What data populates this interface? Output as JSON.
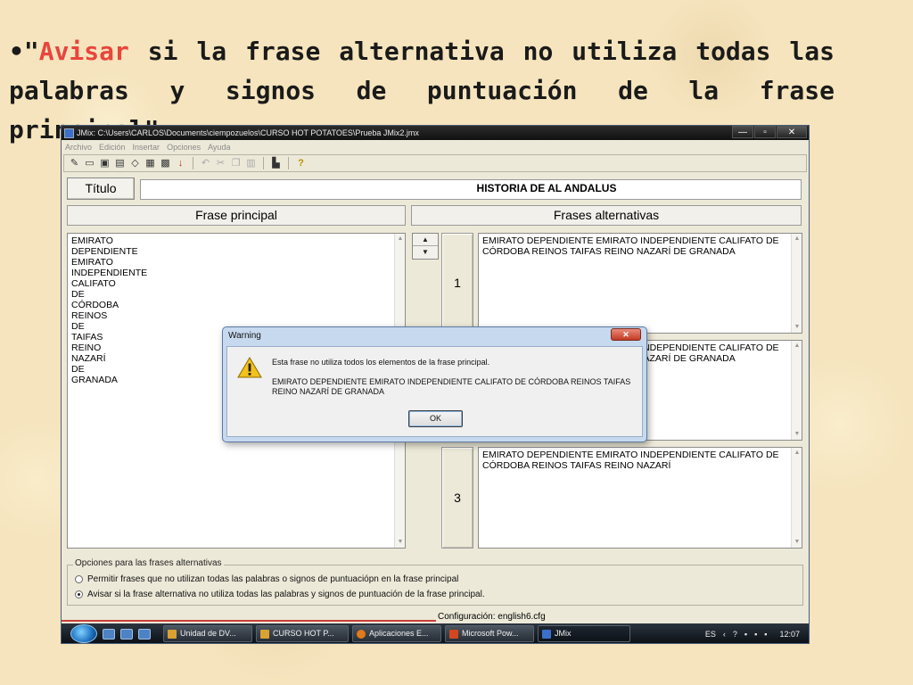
{
  "slide": {
    "bullet": "•",
    "quote_open": "\"",
    "highlight": "Avisar",
    "text": " si la frase alternativa no utiliza todas las palabras y signos de puntuación de la frase principal\"."
  },
  "window": {
    "title": "JMix: C:\\Users\\CARLOS\\Documents\\ciempozuelos\\CURSO HOT POTATOES\\Prueba JMix2.jmx",
    "controls": {
      "minimize": "—",
      "maximize": "▫",
      "close": "✕"
    }
  },
  "menu": [
    "Archivo",
    "Edición",
    "Insertar",
    "Opciones",
    "Ayuda"
  ],
  "toolbar": {
    "icons": [
      "new-icon",
      "open-icon",
      "save-icon",
      "save-as-icon",
      "eraser-icon",
      "web-page-icon",
      "web-drag-icon",
      "export-down-icon",
      "undo-icon",
      "cut-icon",
      "copy-icon",
      "paste-icon",
      "screen-icon",
      "help-icon"
    ]
  },
  "titulo": {
    "button": "Título",
    "value": "HISTORIA DE AL ANDALUS"
  },
  "frase_principal": {
    "header": "Frase principal",
    "lines": [
      "EMIRATO",
      "DEPENDIENTE",
      "EMIRATO",
      "INDEPENDIENTE",
      "CALIFATO",
      "DE",
      "CÓRDOBA",
      "REINOS",
      "DE",
      "TAIFAS",
      "REINO",
      "NAZARÍ",
      "DE",
      "GRANADA"
    ]
  },
  "frases_alternativas": {
    "header": "Frases alternativas",
    "items": [
      {
        "number": "1",
        "text": "EMIRATO DEPENDIENTE EMIRATO INDEPENDIENTE CALIFATO DE CÓRDOBA REINOS TAIFAS REINO NAZARÍ DE GRANADA"
      },
      {
        "number": "2",
        "text": "EMIRATO DEPENDIENTE EMIRATO INDEPENDIENTE CALIFATO DE CÓRDOBA REINOS TAIFAS REINO NAZARÍ DE GRANADA"
      },
      {
        "number": "3",
        "text": "EMIRATO DEPENDIENTE EMIRATO INDEPENDIENTE CALIFATO DE CÓRDOBA REINOS TAIFAS REINO NAZARÍ"
      }
    ]
  },
  "options": {
    "legend": "Opciones para las frases alternativas",
    "allow": "Permitir frases que no utilizan todas las palabras o signos de puntuaciópn en la frase principal",
    "warn": "Avisar si la frase alternativa no utiliza todas las palabras y signos de puntuación de la frase principal.",
    "selected": "warn"
  },
  "status": {
    "config": "Configuración: english6.cfg"
  },
  "taskbar": {
    "tasks": [
      "Unidad de DV...",
      "CURSO HOT P...",
      "Aplicaciones E...",
      "Microsoft Pow...",
      "JMix"
    ],
    "lang": "ES",
    "time": "12:07"
  },
  "dialog": {
    "title": "Warning",
    "close": "✕",
    "message": "Esta frase no utiliza todos los elementos de la frase principal.",
    "sentence": "EMIRATO DEPENDIENTE EMIRATO INDEPENDIENTE CALIFATO DE CÓRDOBA REINOS TAIFAS REINO NAZARÍ DE GRANADA",
    "ok": "OK"
  }
}
